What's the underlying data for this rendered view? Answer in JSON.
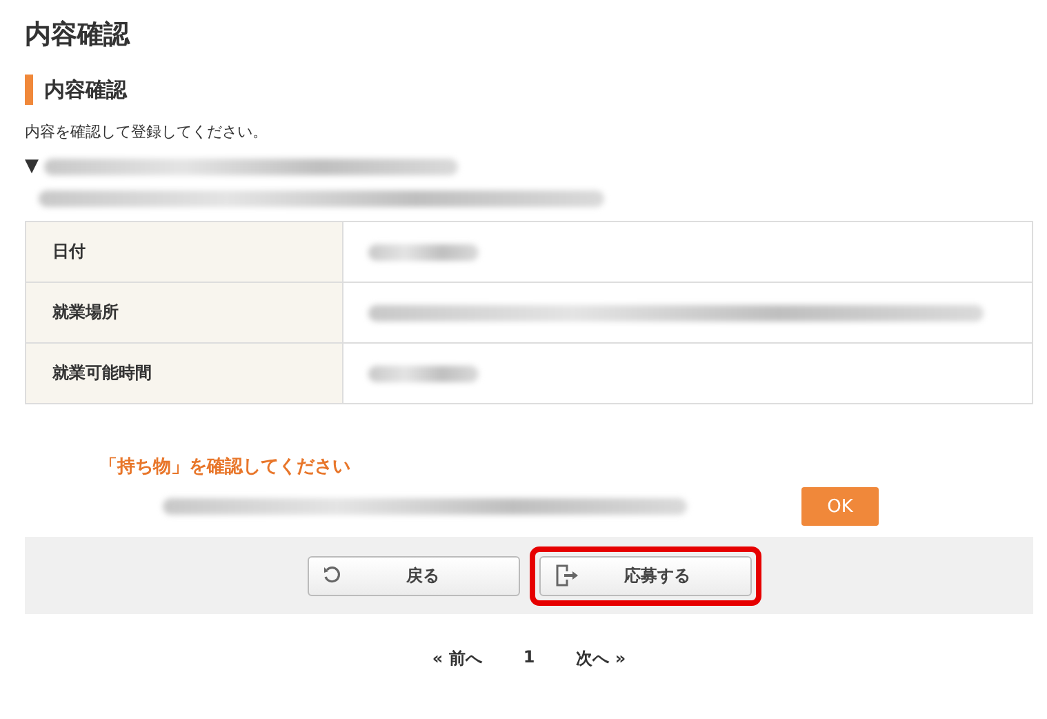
{
  "page_title": "内容確認",
  "section_title": "内容確認",
  "instruction": "内容を確認して登録してください。",
  "job": {
    "marker": "▼"
  },
  "details": [
    {
      "label": "日付",
      "kind": "short"
    },
    {
      "label": "就業場所",
      "kind": "long"
    },
    {
      "label": "就業可能時間",
      "kind": "short"
    }
  ],
  "notice": {
    "title": "「持ち物」を確認してください",
    "ok_button": "OK"
  },
  "actions": [
    {
      "label": "戻る",
      "kind": "back",
      "highlighted": false
    },
    {
      "label": "応募する",
      "kind": "apply",
      "highlighted": true
    }
  ],
  "pagination": {
    "prev": "« 前へ",
    "page": "1",
    "next": "次へ »"
  }
}
